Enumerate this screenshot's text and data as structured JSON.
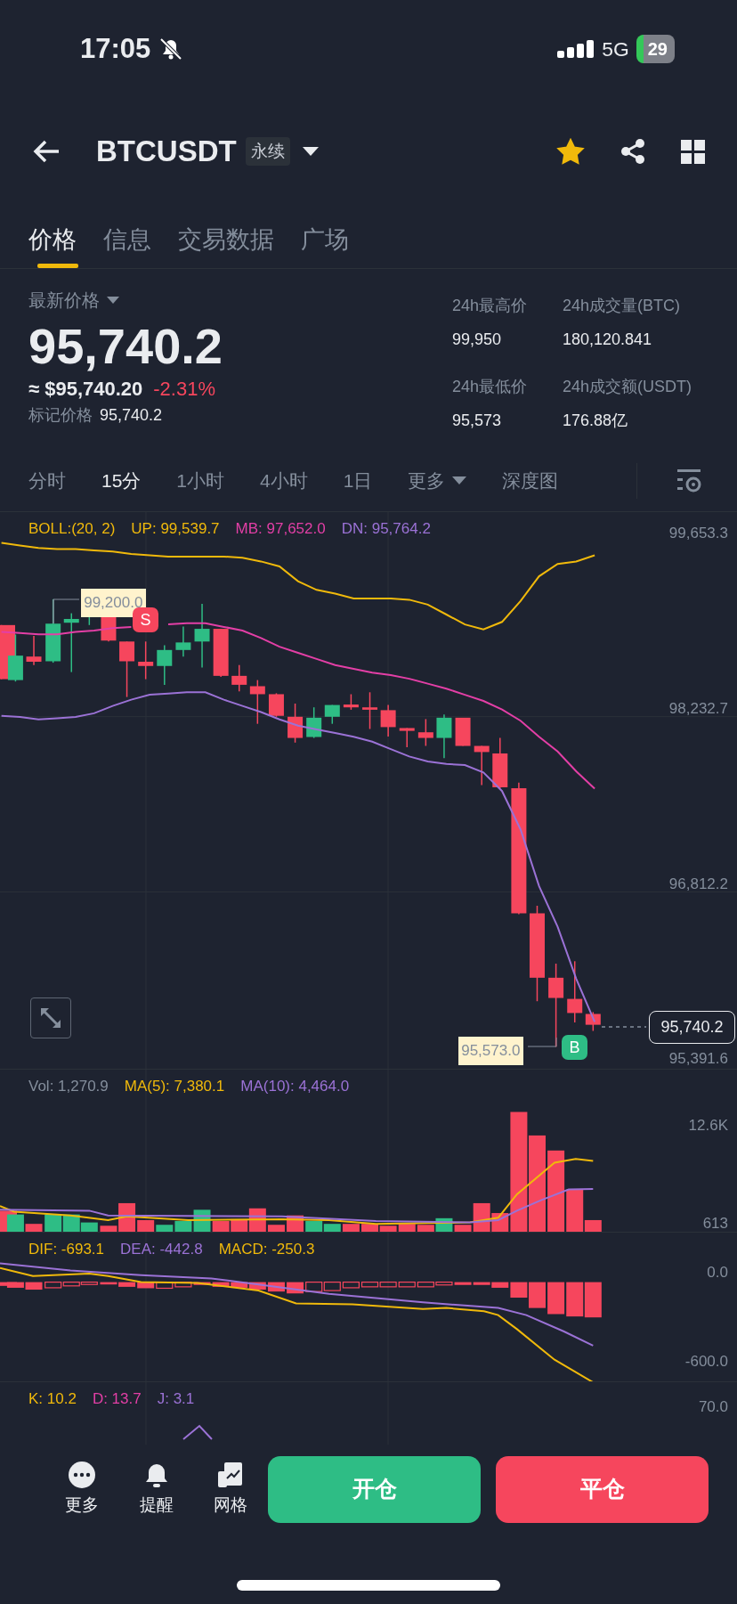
{
  "status_bar": {
    "time": "17:05",
    "network": "5G",
    "battery": "29"
  },
  "header": {
    "symbol": "BTCUSDT",
    "contract_tag": "永续",
    "favorite": true
  },
  "tabs": [
    {
      "label": "价格",
      "selected": true
    },
    {
      "label": "信息",
      "selected": false
    },
    {
      "label": "交易数据",
      "selected": false
    },
    {
      "label": "广场",
      "selected": false
    }
  ],
  "price": {
    "label": "最新价格",
    "last": "95,740.2",
    "usd": "≈ $95,740.20",
    "change": "-2.31%",
    "mark_label": "标记价格",
    "mark": "95,740.2"
  },
  "stats": [
    {
      "label": "24h最高价",
      "value": "99,950"
    },
    {
      "label": "24h成交量(BTC)",
      "value": "180,120.841"
    },
    {
      "label": "24h最低价",
      "value": "95,573"
    },
    {
      "label": "24h成交额(USDT)",
      "value": "176.88亿"
    }
  ],
  "intervals": [
    {
      "label": "分时",
      "selected": false
    },
    {
      "label": "15分",
      "selected": true
    },
    {
      "label": "1小时",
      "selected": false
    },
    {
      "label": "4小时",
      "selected": false
    },
    {
      "label": "1日",
      "selected": false
    },
    {
      "label": "更多",
      "selected": false,
      "dropdown": true
    },
    {
      "label": "深度图",
      "selected": false
    }
  ],
  "main_chart": {
    "indicators": [
      {
        "text": "BOLL:(20, 2)",
        "color": "#f0b90b"
      }
    ],
    "readings": [
      "99,539.7",
      "97,652.0",
      "95,764.2"
    ],
    "chart_data": {
      "type": "line",
      "series": [
        {
          "name": "UP:",
          "color": "#f0b90b",
          "values": [
            99640,
            99620,
            99600,
            99590,
            99590,
            99580,
            99570,
            99550,
            99540,
            99530,
            99530,
            99530,
            99530,
            99520,
            99490,
            99450,
            99330,
            99260,
            99230,
            99190,
            99190,
            99190,
            99180,
            99140,
            99060,
            98980,
            98940,
            99000,
            99170,
            99370,
            99470,
            99490,
            99540
          ]
        },
        {
          "name": "MB:",
          "color": "#e33fa6",
          "values": [
            98920,
            98910,
            98900,
            98900,
            98920,
            98930,
            98950,
            98960,
            null,
            98980,
            98990,
            98990,
            98960,
            98930,
            98870,
            98800,
            98750,
            98700,
            98650,
            98620,
            98590,
            98570,
            98540,
            98500,
            98460,
            98410,
            98360,
            98290,
            98200,
            98070,
            97950,
            97790,
            97650
          ]
        },
        {
          "name": "DN:",
          "color": "#9b72d6",
          "values": [
            98240,
            98230,
            98210,
            98220,
            98230,
            98260,
            98320,
            98370,
            98410,
            98420,
            98430,
            98430,
            98370,
            98320,
            98270,
            98210,
            98160,
            98130,
            98100,
            98070,
            98030,
            97970,
            97910,
            97870,
            97850,
            97840,
            97780,
            97630,
            97320,
            96860,
            96530,
            96110,
            95760
          ]
        }
      ],
      "ylim": [
        95380,
        99890
      ],
      "yticks": [
        {
          "value": 99653.3,
          "label": "99,653.3"
        },
        {
          "value": 98232.7,
          "label": "98,232.7"
        },
        {
          "value": 96812.2,
          "label": "96,812.2"
        },
        {
          "value": 95391.6,
          "label": "95,391.6"
        }
      ]
    },
    "high_marker": "99,200.0",
    "low_marker": "95,573.0",
    "sell_signal": "S",
    "buy_signal": "B",
    "current_price": "95,740.2"
  },
  "volume": {
    "indicators": [
      {
        "text": "Vol: 1,270.9",
        "color": "#848e9c"
      },
      {
        "text": "MA(5): 7,380.1",
        "color": "#f0b90b"
      },
      {
        "text": "MA(10): 4,464.0",
        "color": "#9b72d6"
      }
    ],
    "axis": [
      "12.6K",
      "613"
    ]
  },
  "macd": {
    "indicators": [
      {
        "text": "DIF: -693.1",
        "color": "#f0b90b"
      },
      {
        "text": "DEA: -442.8",
        "color": "#9b72d6"
      },
      {
        "text": "MACD: -250.3",
        "color": "#f0b90b"
      }
    ],
    "axis": [
      "0.0",
      "-600.0"
    ]
  },
  "kdj": {
    "indicators": [
      {
        "text": "K: 10.2",
        "color": "#f0b90b"
      },
      {
        "text": "D: 13.7",
        "color": "#e33fa6"
      },
      {
        "text": "J: 3.1",
        "color": "#9b72d6"
      }
    ],
    "axis": [
      "70.0"
    ]
  },
  "bottom_actions": [
    {
      "label": "更多",
      "kind": "more"
    },
    {
      "label": "提醒",
      "kind": "alert"
    },
    {
      "label": "网格",
      "kind": "grid"
    }
  ],
  "trade_buttons": [
    {
      "label": "开仓",
      "kind": "open"
    },
    {
      "label": "平仓",
      "kind": "close"
    }
  ]
}
